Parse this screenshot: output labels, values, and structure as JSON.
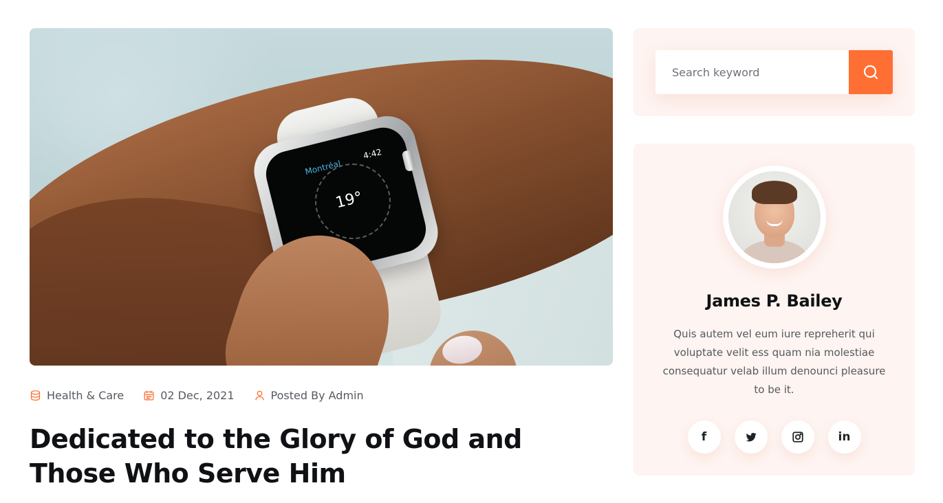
{
  "post": {
    "category": "Health & Care",
    "date": "02 Dec, 2021",
    "author": "Posted By Admin",
    "title": "Dedicated to the Glory of God and Those Who Serve Him",
    "image_icon": "smartwatch-photo"
  },
  "hero_image": {
    "watch_city": "Montréal",
    "watch_time": "4:42",
    "watch_temp": "19°"
  },
  "sidebar": {
    "search": {
      "placeholder": "Search keyword",
      "button_icon": "search-icon"
    },
    "author": {
      "name": "James P. Bailey",
      "bio": "Quis autem vel eum iure repreherit qui voluptate velit ess quam nia molestiae consequatur velab illum denounci pleasure to be it.",
      "socials": [
        {
          "icon": "facebook-icon",
          "label": "f"
        },
        {
          "icon": "twitter-icon",
          "label": ""
        },
        {
          "icon": "instagram-icon",
          "label": ""
        },
        {
          "icon": "linkedin-icon",
          "label": "in"
        }
      ]
    }
  },
  "colors": {
    "accent": "#ff6f33",
    "card_bg": "#fef4f1",
    "heading": "#101114",
    "body_text": "#55595f"
  }
}
